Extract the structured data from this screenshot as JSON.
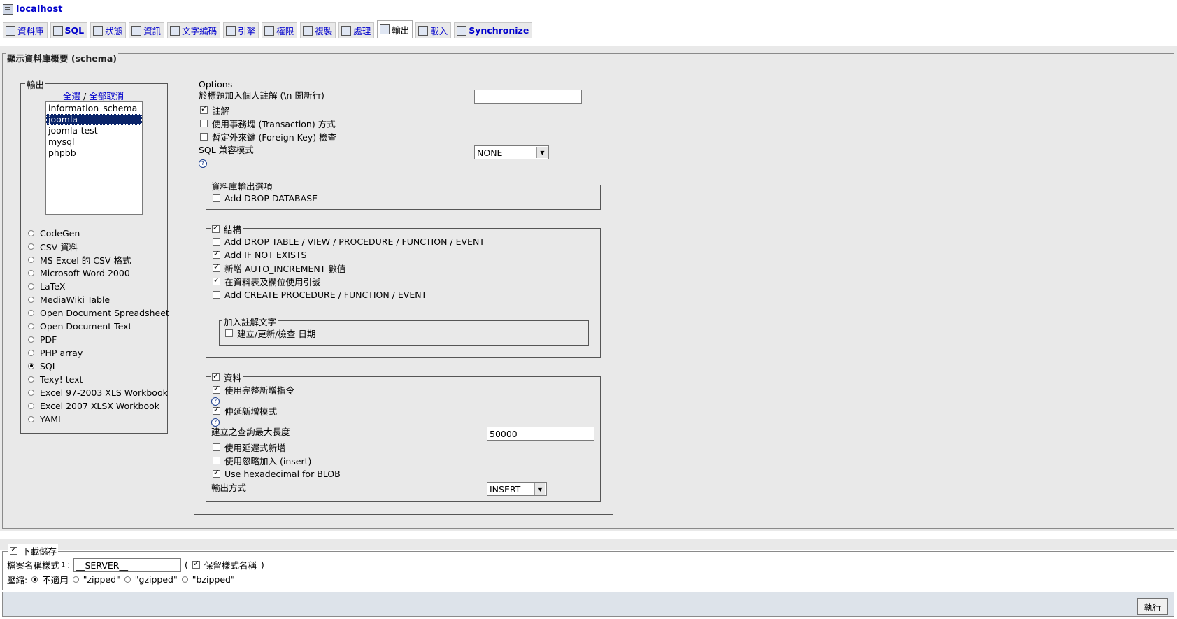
{
  "server": {
    "name": "localhost",
    "icon": "server-icon"
  },
  "tabs": [
    {
      "label": "資料庫",
      "icon": "databases-icon"
    },
    {
      "label": "SQL",
      "icon": "sql-icon"
    },
    {
      "label": "狀態",
      "icon": "status-icon"
    },
    {
      "label": "資訊",
      "icon": "info-icon"
    },
    {
      "label": "文字編碼",
      "icon": "charset-icon"
    },
    {
      "label": "引擎",
      "icon": "engines-icon"
    },
    {
      "label": "權限",
      "icon": "privileges-icon"
    },
    {
      "label": "複製",
      "icon": "replication-icon"
    },
    {
      "label": "處理",
      "icon": "processes-icon"
    },
    {
      "label": "輸出",
      "icon": "export-icon",
      "active": true
    },
    {
      "label": "載入",
      "icon": "import-icon"
    },
    {
      "label": "Synchronize",
      "icon": "synchronize-icon"
    }
  ],
  "main": {
    "legend": "顯示資料庫概要 (schema)",
    "export": {
      "legend": "輸出",
      "select_all": "全選",
      "separator": "/",
      "deselect_all": "全部取消",
      "databases": [
        "information_schema",
        "joomla",
        "joomla-test",
        "mysql",
        "phpbb"
      ],
      "selected_database": "joomla",
      "formats": [
        "CodeGen",
        "CSV 資料",
        "MS Excel 的 CSV 格式",
        "Microsoft Word 2000",
        "LaTeX",
        "MediaWiki Table",
        "Open Document Spreadsheet",
        "Open Document Text",
        "PDF",
        "PHP array",
        "SQL",
        "Texy! text",
        "Excel 97-2003 XLS Workbook",
        "Excel 2007 XLSX Workbook",
        "YAML"
      ],
      "selected_format": "SQL"
    },
    "options": {
      "legend": "Options",
      "header_comment_label": "於標題加入個人註解 (\\n 開新行)",
      "header_comment_value": "",
      "comments_label": "註解",
      "comments_checked": true,
      "transaction_label": "使用事務塊 (Transaction) 方式",
      "transaction_checked": false,
      "foreign_key_label": "暫定外來鍵 (Foreign Key) 檢查",
      "foreign_key_checked": false,
      "compat_label": "SQL 兼容模式",
      "compat_value": "NONE",
      "db_options": {
        "legend": "資料庫輸出選項",
        "drop_database_label": "Add DROP DATABASE",
        "drop_database_checked": false
      },
      "structure": {
        "legend": "結構",
        "checked": true,
        "items": [
          {
            "label": "Add DROP TABLE / VIEW / PROCEDURE / FUNCTION / EVENT",
            "checked": false
          },
          {
            "label": "Add IF NOT EXISTS",
            "checked": true
          },
          {
            "label": "新增 AUTO_INCREMENT 數值",
            "checked": true
          },
          {
            "label": "在資料表及欄位使用引號",
            "checked": true
          },
          {
            "label": "Add CREATE PROCEDURE / FUNCTION / EVENT",
            "checked": false
          }
        ],
        "comments_legend": "加入註解文字",
        "dates_label": "建立/更新/檢查 日期",
        "dates_checked": false
      },
      "data": {
        "legend": "資料",
        "checked": true,
        "complete_inserts_label": "使用完整新增指令",
        "complete_inserts_checked": true,
        "extended_inserts_label": "伸延新增模式",
        "extended_inserts_checked": true,
        "max_query_label": "建立之查詢最大長度",
        "max_query_value": "50000",
        "delayed_label": "使用延遲式新增",
        "delayed_checked": false,
        "ignore_label": "使用忽略加入 (insert)",
        "ignore_checked": false,
        "hex_blob_label": "Use hexadecimal for BLOB",
        "hex_blob_checked": true,
        "export_type_label": "輸出方式",
        "export_type_value": "INSERT"
      }
    }
  },
  "save": {
    "legend": "下載儲存",
    "checked": true,
    "filename_label": "檔案名稱樣式",
    "filename_sup": "1",
    "filename_colon": ":",
    "filename_value": "__SERVER__",
    "paren_open": "(",
    "remember_label": "保留樣式名稱",
    "remember_checked": true,
    "paren_close": ")",
    "compression_label": "壓縮:",
    "compression_options": [
      "不適用",
      "\"zipped\"",
      "\"gzipped\"",
      "\"bzipped\""
    ],
    "compression_selected": "不適用"
  },
  "submit_label": "執行"
}
